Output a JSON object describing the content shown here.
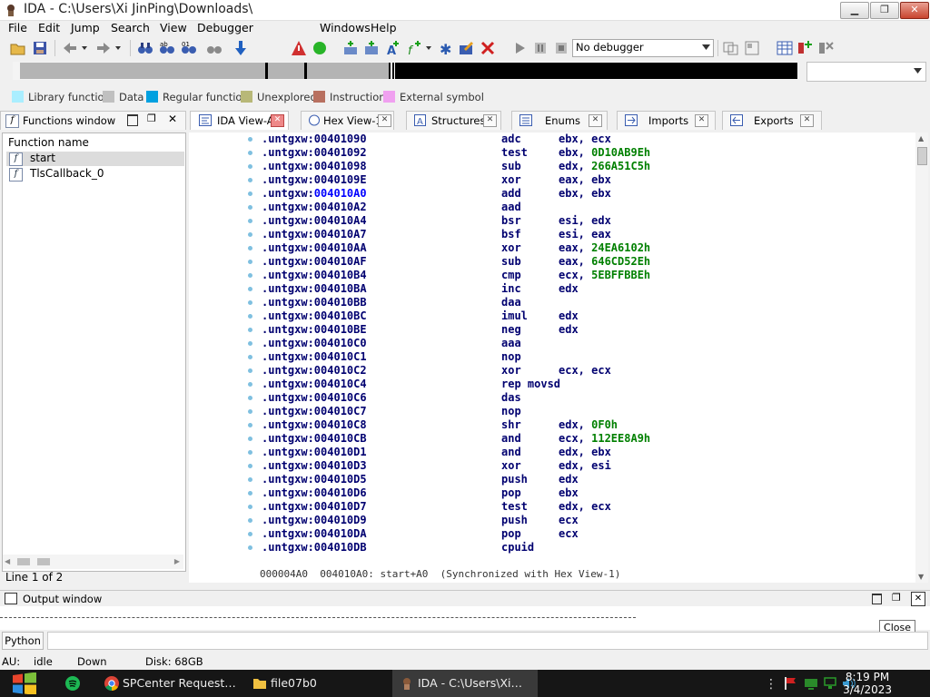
{
  "window": {
    "title": "IDA - C:\\Users\\Xi JinPing\\Downloads\\"
  },
  "menubar": [
    "File",
    "Edit",
    "Jump",
    "Search",
    "View",
    "Debugger",
    "Windows",
    "Help"
  ],
  "toolbar": {
    "debugger_select": "No debugger"
  },
  "legend": [
    {
      "label": "Library function",
      "color": "#aaeeff"
    },
    {
      "label": "Data",
      "color": "#c0c0c0"
    },
    {
      "label": "Regular function",
      "color": "#00a0e0"
    },
    {
      "label": "Unexplored",
      "color": "#b8b878"
    },
    {
      "label": "Instruction",
      "color": "#b87060"
    },
    {
      "label": "External symbol",
      "color": "#f0a0f0"
    }
  ],
  "tabs": {
    "functions_window": "Functions window",
    "ida_view": "IDA View-A",
    "hex_view": "Hex View-1",
    "structures": "Structures",
    "enums": "Enums",
    "imports": "Imports",
    "exports": "Exports"
  },
  "functions": {
    "header": "Function name",
    "items": [
      "start",
      "TlsCallback_0"
    ],
    "line_info": "Line 1 of 2"
  },
  "disasm": {
    "segment": ".untgxw:",
    "rows": [
      {
        "addr": "00401090",
        "mn": "adc",
        "ops": [
          [
            "ebx, ecx",
            false
          ]
        ]
      },
      {
        "addr": "00401092",
        "mn": "test",
        "ops": [
          [
            "ebx, ",
            false
          ],
          [
            "0D10AB9Eh",
            true
          ]
        ]
      },
      {
        "addr": "00401098",
        "mn": "sub",
        "ops": [
          [
            "edx, ",
            false
          ],
          [
            "266A51C5h",
            true
          ]
        ]
      },
      {
        "addr": "0040109E",
        "mn": "xor",
        "ops": [
          [
            "eax, ebx",
            false
          ]
        ]
      },
      {
        "addr": "004010A0",
        "mn": "add",
        "ops": [
          [
            "ebx, ebx",
            false
          ]
        ],
        "hl": true
      },
      {
        "addr": "004010A2",
        "mn": "aad",
        "ops": []
      },
      {
        "addr": "004010A4",
        "mn": "bsr",
        "ops": [
          [
            "esi, edx",
            false
          ]
        ]
      },
      {
        "addr": "004010A7",
        "mn": "bsf",
        "ops": [
          [
            "esi, eax",
            false
          ]
        ]
      },
      {
        "addr": "004010AA",
        "mn": "xor",
        "ops": [
          [
            "eax, ",
            false
          ],
          [
            "24EA6102h",
            true
          ]
        ]
      },
      {
        "addr": "004010AF",
        "mn": "sub",
        "ops": [
          [
            "eax, ",
            false
          ],
          [
            "646CD52Eh",
            true
          ]
        ]
      },
      {
        "addr": "004010B4",
        "mn": "cmp",
        "ops": [
          [
            "ecx, ",
            false
          ],
          [
            "5EBFFBBEh",
            true
          ]
        ]
      },
      {
        "addr": "004010BA",
        "mn": "inc",
        "ops": [
          [
            "edx",
            false
          ]
        ]
      },
      {
        "addr": "004010BB",
        "mn": "daa",
        "ops": []
      },
      {
        "addr": "004010BC",
        "mn": "imul",
        "ops": [
          [
            "edx",
            false
          ]
        ]
      },
      {
        "addr": "004010BE",
        "mn": "neg",
        "ops": [
          [
            "edx",
            false
          ]
        ]
      },
      {
        "addr": "004010C0",
        "mn": "aaa",
        "ops": []
      },
      {
        "addr": "004010C1",
        "mn": "nop",
        "ops": []
      },
      {
        "addr": "004010C2",
        "mn": "xor",
        "ops": [
          [
            "ecx, ecx",
            false
          ]
        ]
      },
      {
        "addr": "004010C4",
        "mn": "rep movsd",
        "ops": []
      },
      {
        "addr": "004010C6",
        "mn": "das",
        "ops": []
      },
      {
        "addr": "004010C7",
        "mn": "nop",
        "ops": []
      },
      {
        "addr": "004010C8",
        "mn": "shr",
        "ops": [
          [
            "edx, ",
            false
          ],
          [
            "0F0h",
            true
          ]
        ]
      },
      {
        "addr": "004010CB",
        "mn": "and",
        "ops": [
          [
            "ecx, ",
            false
          ],
          [
            "112EE8A9h",
            true
          ]
        ]
      },
      {
        "addr": "004010D1",
        "mn": "and",
        "ops": [
          [
            "edx, ebx",
            false
          ]
        ]
      },
      {
        "addr": "004010D3",
        "mn": "xor",
        "ops": [
          [
            "edx, esi",
            false
          ]
        ]
      },
      {
        "addr": "004010D5",
        "mn": "push",
        "ops": [
          [
            "edx",
            false
          ]
        ]
      },
      {
        "addr": "004010D6",
        "mn": "pop",
        "ops": [
          [
            "ebx",
            false
          ]
        ]
      },
      {
        "addr": "004010D7",
        "mn": "test",
        "ops": [
          [
            "edx, ecx",
            false
          ]
        ]
      },
      {
        "addr": "004010D9",
        "mn": "push",
        "ops": [
          [
            "ecx",
            false
          ]
        ]
      },
      {
        "addr": "004010DA",
        "mn": "pop",
        "ops": [
          [
            "ecx",
            false
          ]
        ]
      },
      {
        "addr": "004010DB",
        "mn": "cpuid",
        "ops": []
      }
    ],
    "status": "000004A0  004010A0: start+A0  (Synchronized with Hex View-1)"
  },
  "output": {
    "title": "Output window",
    "python": "Python",
    "tooltip": "Close"
  },
  "statusbar": {
    "au_label": "AU:",
    "au_value": "idle",
    "down": "Down",
    "disk": "Disk: 68GB"
  },
  "taskbar": {
    "items": [
      "SPCenter Request…",
      "file07b0",
      "IDA - C:\\Users\\Xi…"
    ],
    "time": "8:19 PM",
    "date": "3/4/2023"
  }
}
